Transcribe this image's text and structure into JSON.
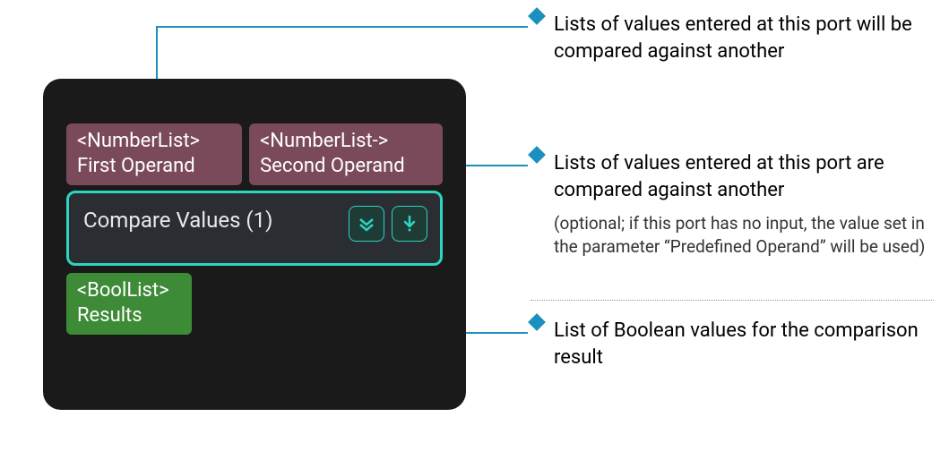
{
  "node": {
    "inputPort1": {
      "type": "<NumberList>",
      "label": "First Operand"
    },
    "inputPort2": {
      "type": "<NumberList->",
      "label": "Second Operand"
    },
    "title": "Compare Values (1)",
    "outputPort1": {
      "type": "<BoolList>",
      "label": "Results"
    }
  },
  "annotations": {
    "a1": "Lists of values entered at this port will be compared against another",
    "a2": "Lists of values entered at this port are compared against another",
    "a2_note": "(optional; if this port has no input, the value set in the parameter “Predefined Operand” will be used)",
    "a3": "List of Boolean values for the comparison result"
  },
  "colors": {
    "panel": "#1a1a1a",
    "inputPort": "#7a4a5a",
    "outputPort": "#3d8b37",
    "nodeBorder": "#2dd4bf",
    "connector": "#1b8fbd"
  }
}
